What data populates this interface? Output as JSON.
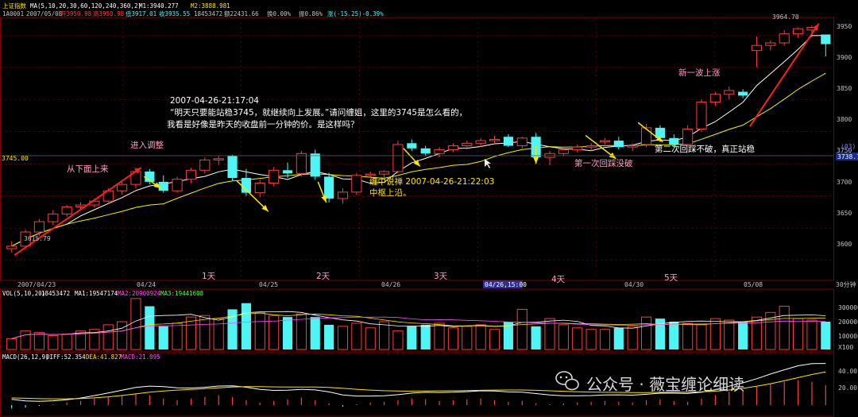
{
  "header": {
    "index_name": "上证指数",
    "ma_params": "MA(5,10,20,30,60,120,240,360,2)",
    "m1": "M1:3940.277",
    "m2": "M2:3888.981",
    "code": "1A0001",
    "date": "2007/05/08",
    "open": "开3950.98",
    "high": "高3950.98",
    "low": "低3917.01",
    "close": "收3935.55",
    "volume": "18453472",
    "amount": "额22431.66",
    "turnover": "换0.00%",
    "amplitude": "振0.86%",
    "change": "涨(-15.25)-0.39%"
  },
  "price_axis": {
    "ticks": [
      "3950",
      "3900",
      "3850",
      "3800",
      "3750",
      "3700",
      "3650",
      "3600"
    ],
    "ref_line_left": "3745.00",
    "ref_line_right": "3738.76",
    "ref_tag": "(03)"
  },
  "date_axis": {
    "labels": [
      "2007/04/23",
      "04/24",
      "04/25",
      "04/26",
      "04/26,15:00",
      "04/30",
      "05/08"
    ],
    "period_label": "30分钟"
  },
  "day_labels": [
    "1天",
    "2天",
    "3天",
    "4天",
    "5天"
  ],
  "annotations": {
    "from_below": "从下面上来",
    "enter_adjust": "进入调整",
    "question_title": "2007-04-26-21:17:04",
    "question_line1": "“明天只要能站稳3745，就继续向上发展。”请问缠姐，这里的3745是怎么看的，",
    "question_line2": "我看是好像是昨天的收盘前一分钟的价。是这样吗？",
    "answer_title": "缠中说禅 2007-04-26-21:22:03",
    "answer_line": "中枢上沿。",
    "first_pullback": "第一次回踩没破",
    "second_pullback": "第二次回踩不破，真正站稳",
    "new_wave": "新一波上涨",
    "low_label": "3615.79",
    "high_label": "3964.70"
  },
  "volume_header": {
    "vol_params": "VOL(5,10,20)",
    "vol_value": "18453472",
    "ma1": "MA1:19547174",
    "ma2": "MA2:20900924",
    "ma3": "MA3:19441608",
    "ticks": [
      "300000",
      "200000",
      "100000",
      "X100"
    ]
  },
  "macd_header": {
    "params": "MACD(26,12,9)",
    "diff": "DIFF:52.354",
    "dea": "DEA:41.827",
    "macd": "MACD:21.095",
    "ticks": [
      "40.00",
      "20.00"
    ]
  },
  "watermark": "公众号 · 薇宝缠论细读",
  "colors": {
    "up": "#ff3b3b",
    "down": "#4ff5f5",
    "ma_white": "#ffffff",
    "ma_yellow": "#f2f200",
    "grid": "#7a0000",
    "annotation": "#ffe400",
    "pink": "#ff9dc6",
    "arrow_red": "#ff2020"
  },
  "chart_data": {
    "type": "candlestick",
    "title": "上证指数",
    "period": "30分钟",
    "ylim": [
      3570,
      3975
    ],
    "candles": [
      {
        "o": 3618,
        "h": 3630,
        "l": 3612,
        "c": 3622
      },
      {
        "o": 3622,
        "h": 3648,
        "l": 3618,
        "c": 3644
      },
      {
        "o": 3644,
        "h": 3664,
        "l": 3638,
        "c": 3660
      },
      {
        "o": 3660,
        "h": 3678,
        "l": 3655,
        "c": 3672
      },
      {
        "o": 3672,
        "h": 3686,
        "l": 3668,
        "c": 3683
      },
      {
        "o": 3683,
        "h": 3690,
        "l": 3678,
        "c": 3686
      },
      {
        "o": 3686,
        "h": 3696,
        "l": 3682,
        "c": 3692
      },
      {
        "o": 3692,
        "h": 3712,
        "l": 3688,
        "c": 3708
      },
      {
        "o": 3708,
        "h": 3722,
        "l": 3702,
        "c": 3718
      },
      {
        "o": 3718,
        "h": 3744,
        "l": 3712,
        "c": 3738
      },
      {
        "o": 3738,
        "h": 3742,
        "l": 3718,
        "c": 3722
      },
      {
        "o": 3722,
        "h": 3732,
        "l": 3705,
        "c": 3708
      },
      {
        "o": 3708,
        "h": 3730,
        "l": 3705,
        "c": 3726
      },
      {
        "o": 3726,
        "h": 3744,
        "l": 3720,
        "c": 3740
      },
      {
        "o": 3740,
        "h": 3760,
        "l": 3735,
        "c": 3756
      },
      {
        "o": 3756,
        "h": 3762,
        "l": 3748,
        "c": 3758
      },
      {
        "o": 3762,
        "h": 3764,
        "l": 3724,
        "c": 3728
      },
      {
        "o": 3728,
        "h": 3742,
        "l": 3700,
        "c": 3705
      },
      {
        "o": 3705,
        "h": 3725,
        "l": 3698,
        "c": 3720
      },
      {
        "o": 3720,
        "h": 3745,
        "l": 3715,
        "c": 3740
      },
      {
        "o": 3740,
        "h": 3752,
        "l": 3728,
        "c": 3735
      },
      {
        "o": 3735,
        "h": 3770,
        "l": 3730,
        "c": 3766
      },
      {
        "o": 3766,
        "h": 3772,
        "l": 3725,
        "c": 3730
      },
      {
        "o": 3730,
        "h": 3736,
        "l": 3690,
        "c": 3696
      },
      {
        "o": 3696,
        "h": 3712,
        "l": 3688,
        "c": 3706
      },
      {
        "o": 3706,
        "h": 3736,
        "l": 3702,
        "c": 3732
      },
      {
        "o": 3732,
        "h": 3738,
        "l": 3728,
        "c": 3734
      },
      {
        "o": 3734,
        "h": 3740,
        "l": 3725,
        "c": 3738
      },
      {
        "o": 3738,
        "h": 3786,
        "l": 3735,
        "c": 3780
      },
      {
        "o": 3782,
        "h": 3788,
        "l": 3770,
        "c": 3774
      },
      {
        "o": 3774,
        "h": 3778,
        "l": 3762,
        "c": 3766
      },
      {
        "o": 3766,
        "h": 3776,
        "l": 3760,
        "c": 3772
      },
      {
        "o": 3772,
        "h": 3782,
        "l": 3768,
        "c": 3778
      },
      {
        "o": 3778,
        "h": 3786,
        "l": 3772,
        "c": 3782
      },
      {
        "o": 3782,
        "h": 3790,
        "l": 3776,
        "c": 3786
      },
      {
        "o": 3786,
        "h": 3794,
        "l": 3780,
        "c": 3788
      },
      {
        "o": 3792,
        "h": 3796,
        "l": 3776,
        "c": 3778
      },
      {
        "o": 3778,
        "h": 3792,
        "l": 3774,
        "c": 3790
      },
      {
        "o": 3792,
        "h": 3798,
        "l": 3755,
        "c": 3760
      },
      {
        "o": 3760,
        "h": 3770,
        "l": 3748,
        "c": 3766
      },
      {
        "o": 3766,
        "h": 3776,
        "l": 3762,
        "c": 3772
      },
      {
        "o": 3772,
        "h": 3780,
        "l": 3768,
        "c": 3776
      },
      {
        "o": 3776,
        "h": 3782,
        "l": 3770,
        "c": 3778
      },
      {
        "o": 3784,
        "h": 3790,
        "l": 3780,
        "c": 3786
      },
      {
        "o": 3786,
        "h": 3792,
        "l": 3772,
        "c": 3776
      },
      {
        "o": 3776,
        "h": 3782,
        "l": 3770,
        "c": 3778
      },
      {
        "o": 3780,
        "h": 3812,
        "l": 3776,
        "c": 3806
      },
      {
        "o": 3806,
        "h": 3810,
        "l": 3784,
        "c": 3790
      },
      {
        "o": 3790,
        "h": 3796,
        "l": 3776,
        "c": 3780
      },
      {
        "o": 3780,
        "h": 3810,
        "l": 3778,
        "c": 3804
      },
      {
        "o": 3804,
        "h": 3850,
        "l": 3800,
        "c": 3846
      },
      {
        "o": 3846,
        "h": 3862,
        "l": 3840,
        "c": 3858
      },
      {
        "o": 3858,
        "h": 3870,
        "l": 3850,
        "c": 3864
      },
      {
        "o": 3862,
        "h": 3866,
        "l": 3852,
        "c": 3856
      },
      {
        "o": 3926,
        "h": 3948,
        "l": 3900,
        "c": 3934
      },
      {
        "o": 3934,
        "h": 3942,
        "l": 3926,
        "c": 3938
      },
      {
        "o": 3938,
        "h": 3958,
        "l": 3934,
        "c": 3952
      },
      {
        "o": 3952,
        "h": 3962,
        "l": 3946,
        "c": 3960
      },
      {
        "o": 3958,
        "h": 3965,
        "l": 3952,
        "c": 3962
      },
      {
        "o": 3951,
        "h": 3951,
        "l": 3917,
        "c": 3936
      }
    ],
    "volume_x100": [
      70,
      120,
      110,
      90,
      100,
      120,
      130,
      160,
      180,
      330,
      280,
      150,
      170,
      210,
      220,
      200,
      260,
      300,
      240,
      220,
      210,
      230,
      210,
      160,
      150,
      170,
      140,
      180,
      120,
      150,
      160,
      170,
      140,
      150,
      160,
      130,
      180,
      260,
      150,
      200,
      160,
      140,
      130,
      130,
      140,
      150,
      210,
      200,
      180,
      170,
      160,
      200,
      190,
      180,
      210,
      240,
      280,
      200,
      190,
      180
    ],
    "macd_hist": [
      -4,
      -3,
      -1,
      1,
      3,
      5,
      8,
      10,
      12,
      14,
      12,
      8,
      6,
      8,
      10,
      12,
      10,
      6,
      3,
      5,
      7,
      9,
      6,
      2,
      -2,
      1,
      3,
      4,
      6,
      8,
      7,
      5,
      6,
      7,
      8,
      6,
      4,
      5,
      2,
      1,
      2,
      3,
      4,
      5,
      4,
      3,
      6,
      7,
      5,
      4,
      8,
      12,
      16,
      18,
      22,
      26,
      28,
      30,
      28,
      24
    ],
    "diff_last": 52.354,
    "dea_last": 41.827,
    "macd_last": 21.095
  }
}
